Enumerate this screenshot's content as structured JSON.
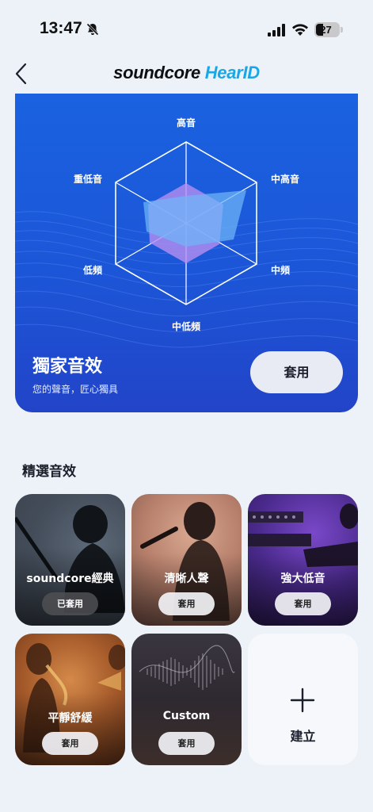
{
  "status_bar": {
    "time": "13:47",
    "battery": "27"
  },
  "header": {
    "brand_primary": "soundcore",
    "brand_secondary": "HearID"
  },
  "hero": {
    "title": "獨家音效",
    "subtitle": "您的聲音，匠心獨具",
    "apply_label": "套用",
    "radar_labels": {
      "top": "高音",
      "top_right": "中高音",
      "bottom_right": "中頻",
      "bottom": "中低頻",
      "bottom_left": "低頻",
      "top_left": "重低音"
    }
  },
  "section": {
    "title": "精選音效"
  },
  "presets": [
    {
      "name": "soundcore經典",
      "button": "已套用",
      "applied": true
    },
    {
      "name": "清晰人聲",
      "button": "套用",
      "applied": false
    },
    {
      "name": "強大低音",
      "button": "套用",
      "applied": false
    },
    {
      "name": "平靜舒緩",
      "button": "套用",
      "applied": false
    },
    {
      "name": "Custom",
      "button": "套用",
      "applied": false
    }
  ],
  "create": {
    "label": "建立",
    "icon": "plus-icon"
  },
  "colors": {
    "accent": "#1aa7e5",
    "hero_blue": "#1c56d8",
    "page_bg": "#edf2f8"
  }
}
